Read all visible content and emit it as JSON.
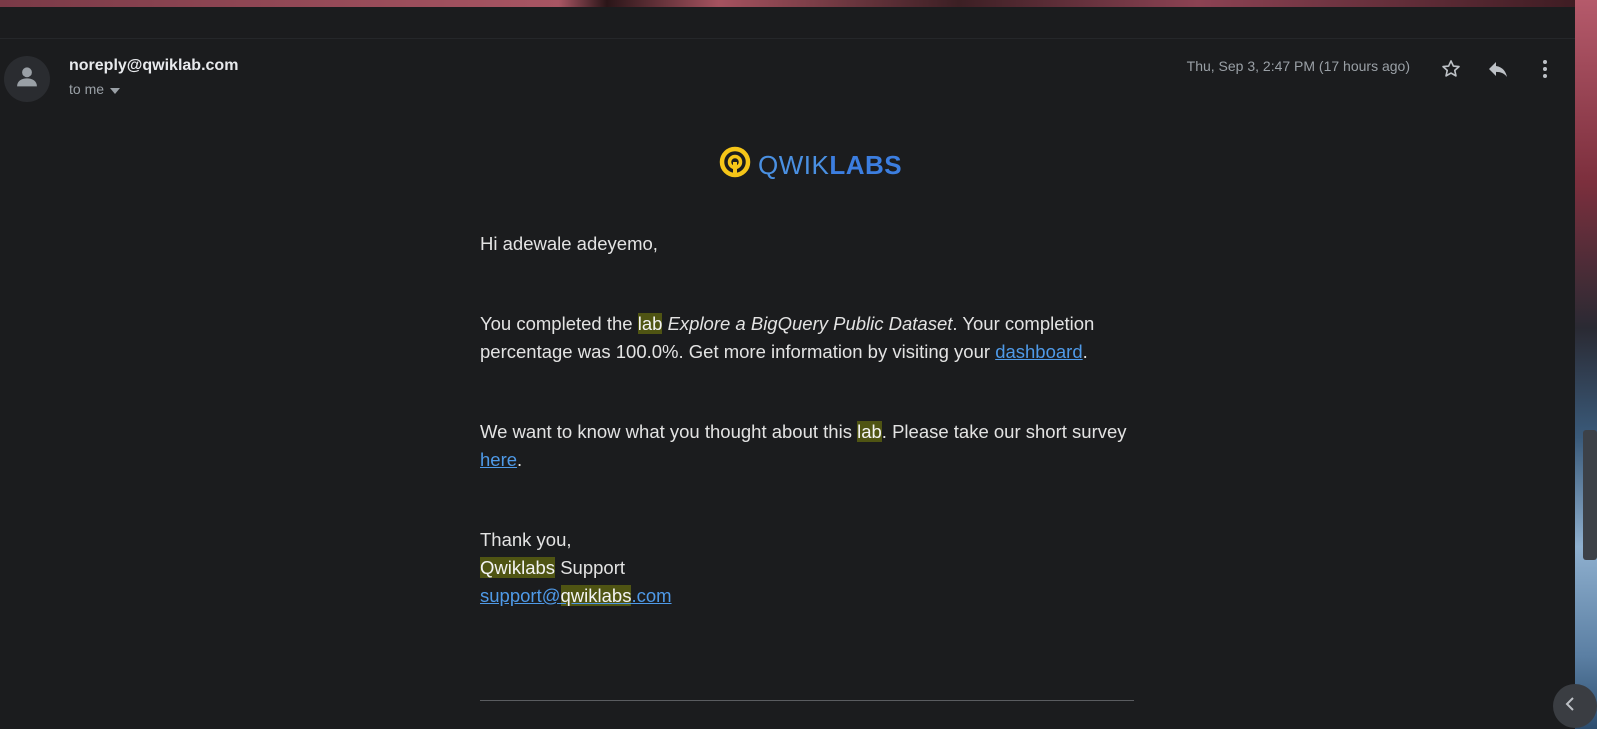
{
  "email": {
    "sender": "noreply@qwiklab.com",
    "recipient": "to me",
    "date": "Thu, Sep 3, 2:47 PM (17 hours ago)"
  },
  "logo": {
    "brand_light": "QWIK",
    "brand_bold": "LABS"
  },
  "message": {
    "greeting": "Hi adewale adeyemo,",
    "p1_intro": "You completed the ",
    "p1_lab": "lab",
    "p1_space": " ",
    "p1_title": "Explore a BigQuery Public Dataset",
    "p1_rest": ". Your completion percentage was 100.0%. Get more information by visiting your ",
    "p1_link": "dashboard",
    "p1_end": ".",
    "p2_intro": "We want to know what you thought about this ",
    "p2_lab": "lab",
    "p2_rest": ". Please take our short survey ",
    "p2_link": "here",
    "p2_end": ".",
    "thanks": "Thank you,",
    "sig_brand": "Qwiklabs",
    "sig_rest": " Support",
    "email_pre": "support@",
    "email_brand": "qwiklabs",
    "email_post": ".com"
  },
  "icons": [
    "person-icon",
    "chevron-down-icon",
    "star-icon",
    "reply-icon",
    "more-vert-icon",
    "chevron-left-icon",
    "qwiklabs-logo-icon"
  ],
  "colors": {
    "background": "#1b1c1e",
    "link": "#4f9ae8",
    "highlight": "#4f5413",
    "logo_yellow": "#f5c518",
    "logo_blue": "#4a90e2"
  }
}
